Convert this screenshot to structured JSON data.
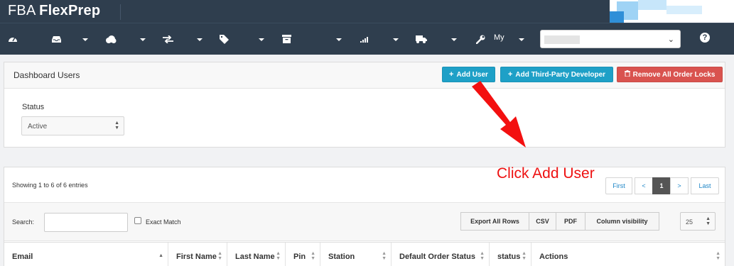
{
  "brand": {
    "light": "FBA ",
    "bold": "FlexPrep"
  },
  "navbar": {
    "icons": [
      "dashboard-icon",
      "inbox-icon",
      "cloud-icon",
      "transfer-icon",
      "tags-icon",
      "archive-icon",
      "signal-icon",
      "truck-icon",
      "wrench-icon"
    ],
    "my_label": "My",
    "help_label": "?"
  },
  "dashboard_users": {
    "title": "Dashboard Users",
    "add_user_label": "Add User",
    "add_third_party_label": "Add Third-Party Developer",
    "remove_locks_label": "Remove All Order Locks",
    "status_label": "Status",
    "status_value": "Active"
  },
  "table_panel": {
    "showing_text": "Showing 1 to 6 of 6 entries",
    "pagination": {
      "first": "First",
      "prev": "<",
      "current": "1",
      "next": ">",
      "last": "Last"
    },
    "search_label": "Search:",
    "search_value": "",
    "exact_match_label": "Exact Match",
    "export_buttons": [
      "Export All Rows",
      "CSV",
      "PDF",
      "Column visibility"
    ],
    "page_length": "25",
    "columns": [
      "Email",
      "First Name",
      "Last Name",
      "Pin",
      "Station",
      "Default Order Status",
      "status",
      "Actions"
    ]
  },
  "annotation": {
    "text": "Click Add User",
    "color": "#ee1111"
  },
  "colors": {
    "header_bg": "#2f3e4e",
    "teal_button": "#1ea0c7",
    "red_button": "#d9534f"
  }
}
